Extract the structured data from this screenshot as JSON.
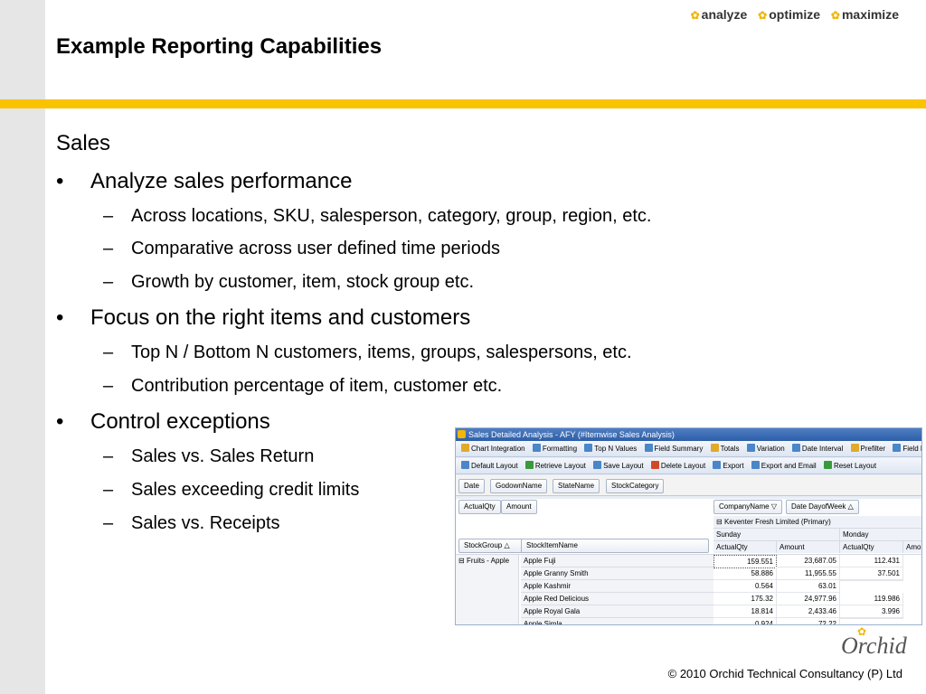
{
  "header": {
    "title": "Example Reporting Capabilities",
    "tagline": [
      "analyze",
      "optimize",
      "maximize"
    ]
  },
  "body": {
    "section": "Sales",
    "bullets": [
      {
        "text": "Analyze sales performance",
        "subs": [
          "Across locations, SKU, salesperson, category, group, region, etc.",
          "Comparative across user defined time periods",
          "Growth by customer, item, stock group etc."
        ]
      },
      {
        "text": "Focus on the right items and customers",
        "subs": [
          "Top N / Bottom N customers, items, groups, salespersons, etc.",
          "Contribution percentage of item, customer etc."
        ]
      },
      {
        "text": "Control exceptions",
        "subs": [
          "Sales vs. Sales Return",
          "Sales exceeding credit limits",
          "Sales vs. Receipts"
        ]
      }
    ]
  },
  "app": {
    "window_title": "Sales Detailed Analysis - AFY (#Itemwise Sales Analysis)",
    "toolbar1": [
      "Chart Integration",
      "Formatting",
      "Top N Values",
      "Field Summary",
      "Totals",
      "Variation",
      "Date Interval",
      "Prefilter",
      "Field Li"
    ],
    "toolbar2": [
      "Default Layout",
      "Retrieve Layout",
      "Save Layout",
      "Delete Layout",
      "Export",
      "Export and Email",
      "Reset Layout"
    ],
    "filter_fields": [
      "Date",
      "GodownName",
      "StateName",
      "StockCategory"
    ],
    "data_fields": [
      "ActualQty",
      "Amount"
    ],
    "column_fields": [
      "CompanyName",
      "Date DayofWeek"
    ],
    "row_fields": [
      "StockGroup",
      "StockItemName"
    ],
    "company": "Keventer Fresh Limited (Primary)",
    "days": [
      "Sunday",
      "Monday"
    ],
    "col_headers": [
      "ActualQty",
      "Amount",
      "ActualQty",
      "Amo"
    ],
    "group_label": "Fruits - Apple",
    "rows": [
      {
        "item": "Apple Fuji",
        "v1": "159.551",
        "v2": "23,687.05",
        "v3": "112.431"
      },
      {
        "item": "Apple Granny Smith",
        "v1": "58.886",
        "v2": "11,955.55",
        "v3": "37.501"
      },
      {
        "item": "Apple Kashmir",
        "v1": "0.564",
        "v2": "63.01",
        "v3": ""
      },
      {
        "item": "Apple Red Delicious",
        "v1": "175.32",
        "v2": "24,977.96",
        "v3": "119.986"
      },
      {
        "item": "Apple Royal Gala",
        "v1": "18.814",
        "v2": "2,433.46",
        "v3": "3.996"
      },
      {
        "item": "Apple Simla",
        "v1": "0.924",
        "v2": "72.22",
        "v3": ""
      }
    ],
    "colors": {
      "toolbar_icon_1": "#e2a92b",
      "toolbar_icon_2": "#4a86c8",
      "toolbar_icon_3": "#d04a2a",
      "toolbar_icon_4": "#3a9a3a"
    }
  },
  "footer": {
    "copyright": "© 2010 Orchid Technical Consultancy (P) Ltd",
    "logo": "Orchid"
  }
}
